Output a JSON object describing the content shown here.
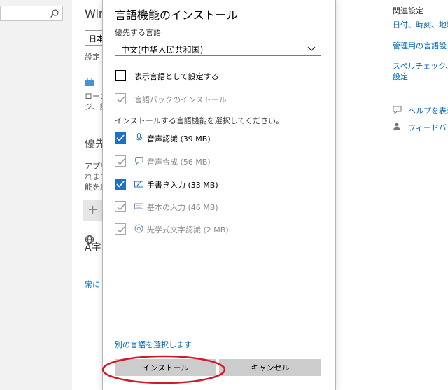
{
  "background": {
    "page_title": "Win",
    "region_text": "日本",
    "settings_text": "設定",
    "local_lines": [
      "ローカ",
      "ジ、設"
    ],
    "priority_heading": "優先",
    "app_lines": [
      "アプリ",
      "れます",
      "能を順"
    ],
    "plus_label": "+",
    "language_glyph": "A字",
    "always_link": "常に"
  },
  "right_panel": {
    "heading": "関連設定",
    "links": [
      "日付、時刻、地域",
      "管理用の言語設",
      "スペルチェック、入力",
      "設定"
    ],
    "help": "ヘルプを表示",
    "feedback": "フィードバック"
  },
  "dialog": {
    "title": "言語機能のインストール",
    "preferred_label": "優先する言語",
    "selected_language": "中文(中华人民共和国)",
    "display_language_option": "表示言語として設定する",
    "language_pack_option": "言語パックのインストール",
    "features_label": "インストールする言語機能を選択してください。",
    "features": [
      {
        "icon": "microphone-icon",
        "label": "音声認識 (39 MB)",
        "checked": true
      },
      {
        "icon": "speech-bubble-icon",
        "label": "音声合成 (56 MB)",
        "checked": false
      },
      {
        "icon": "handwriting-icon",
        "label": "手書き入力 (33 MB)",
        "checked": true
      },
      {
        "icon": "keyboard-icon",
        "label": "基本の入力 (46 MB)",
        "checked": false
      },
      {
        "icon": "ocr-icon",
        "label": "光学式文字認識 (2 MB)",
        "checked": false
      }
    ],
    "other_language_link": "別の言語を選択します",
    "install_button": "インストール",
    "cancel_button": "キャンセル"
  },
  "colors": {
    "accent": "#1f6fc5",
    "link": "#0067b8",
    "highlight_ellipse": "#d01a2a"
  }
}
